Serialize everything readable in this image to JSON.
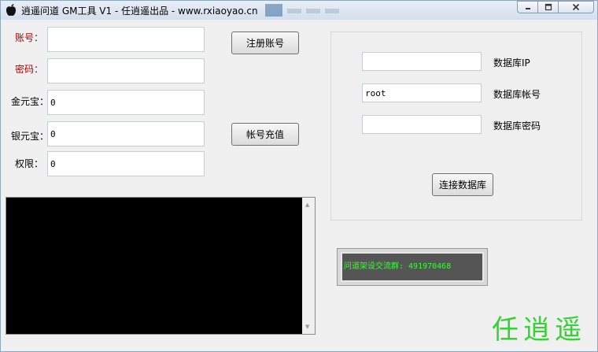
{
  "window": {
    "title": "逍遥问道 GM工具 V1 - 任逍遥出品 - www.rxiaoyao.cn",
    "buttons": [
      "minimize",
      "maximize",
      "close"
    ]
  },
  "account": {
    "labels": {
      "account": "账号：",
      "password": "密码：",
      "gold": "金元宝：",
      "silver": "银元宝：",
      "permission": "权限："
    },
    "values": {
      "account": "",
      "password": "",
      "gold": "0",
      "silver": "0",
      "permission": "0"
    },
    "register_button": "注册账号",
    "recharge_button": "帐号充值"
  },
  "database": {
    "ip_label": "数据库IP",
    "ip_value": "",
    "user_label": "数据库帐号",
    "user_value": "root",
    "password_label": "数据库密码",
    "password_value": "",
    "connect_button": "连接数据库"
  },
  "qq_group": "问道架设交流群: 491970468",
  "brand_text": "任逍遥",
  "colors": {
    "required_label": "#b00000",
    "console_bg": "#000000",
    "brand": "#35d235",
    "qq_text": "#33ff33"
  },
  "icons": {
    "app": "apple-icon",
    "minimize": "minimize-icon",
    "maximize": "maximize-icon",
    "close": "close-icon"
  }
}
